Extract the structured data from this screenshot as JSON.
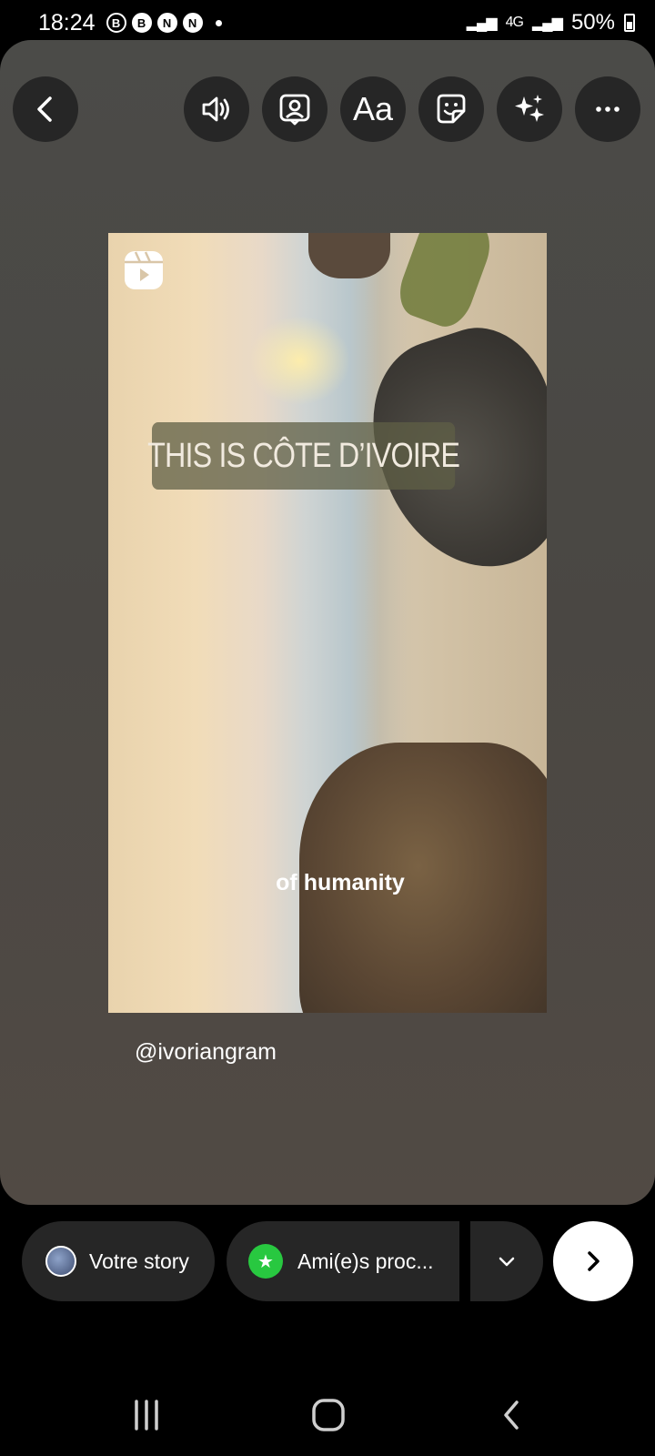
{
  "status_bar": {
    "time": "18:24",
    "notification_icons": [
      "B",
      "B",
      "N",
      "N"
    ],
    "network": "4G",
    "battery": "50%"
  },
  "toolbar": {
    "text_tool_label": "Aa"
  },
  "reel": {
    "title_overlay": "THIS IS CÔTE D’IVOIRE",
    "caption": "of humanity"
  },
  "mention": "@ivoriangram",
  "share": {
    "your_story_label": "Votre story",
    "close_friends_label": "Ami(e)s proc..."
  },
  "colors": {
    "canvas_bg": "#4a4743",
    "button_bg": "#262626",
    "close_friends_green": "#28c840"
  }
}
